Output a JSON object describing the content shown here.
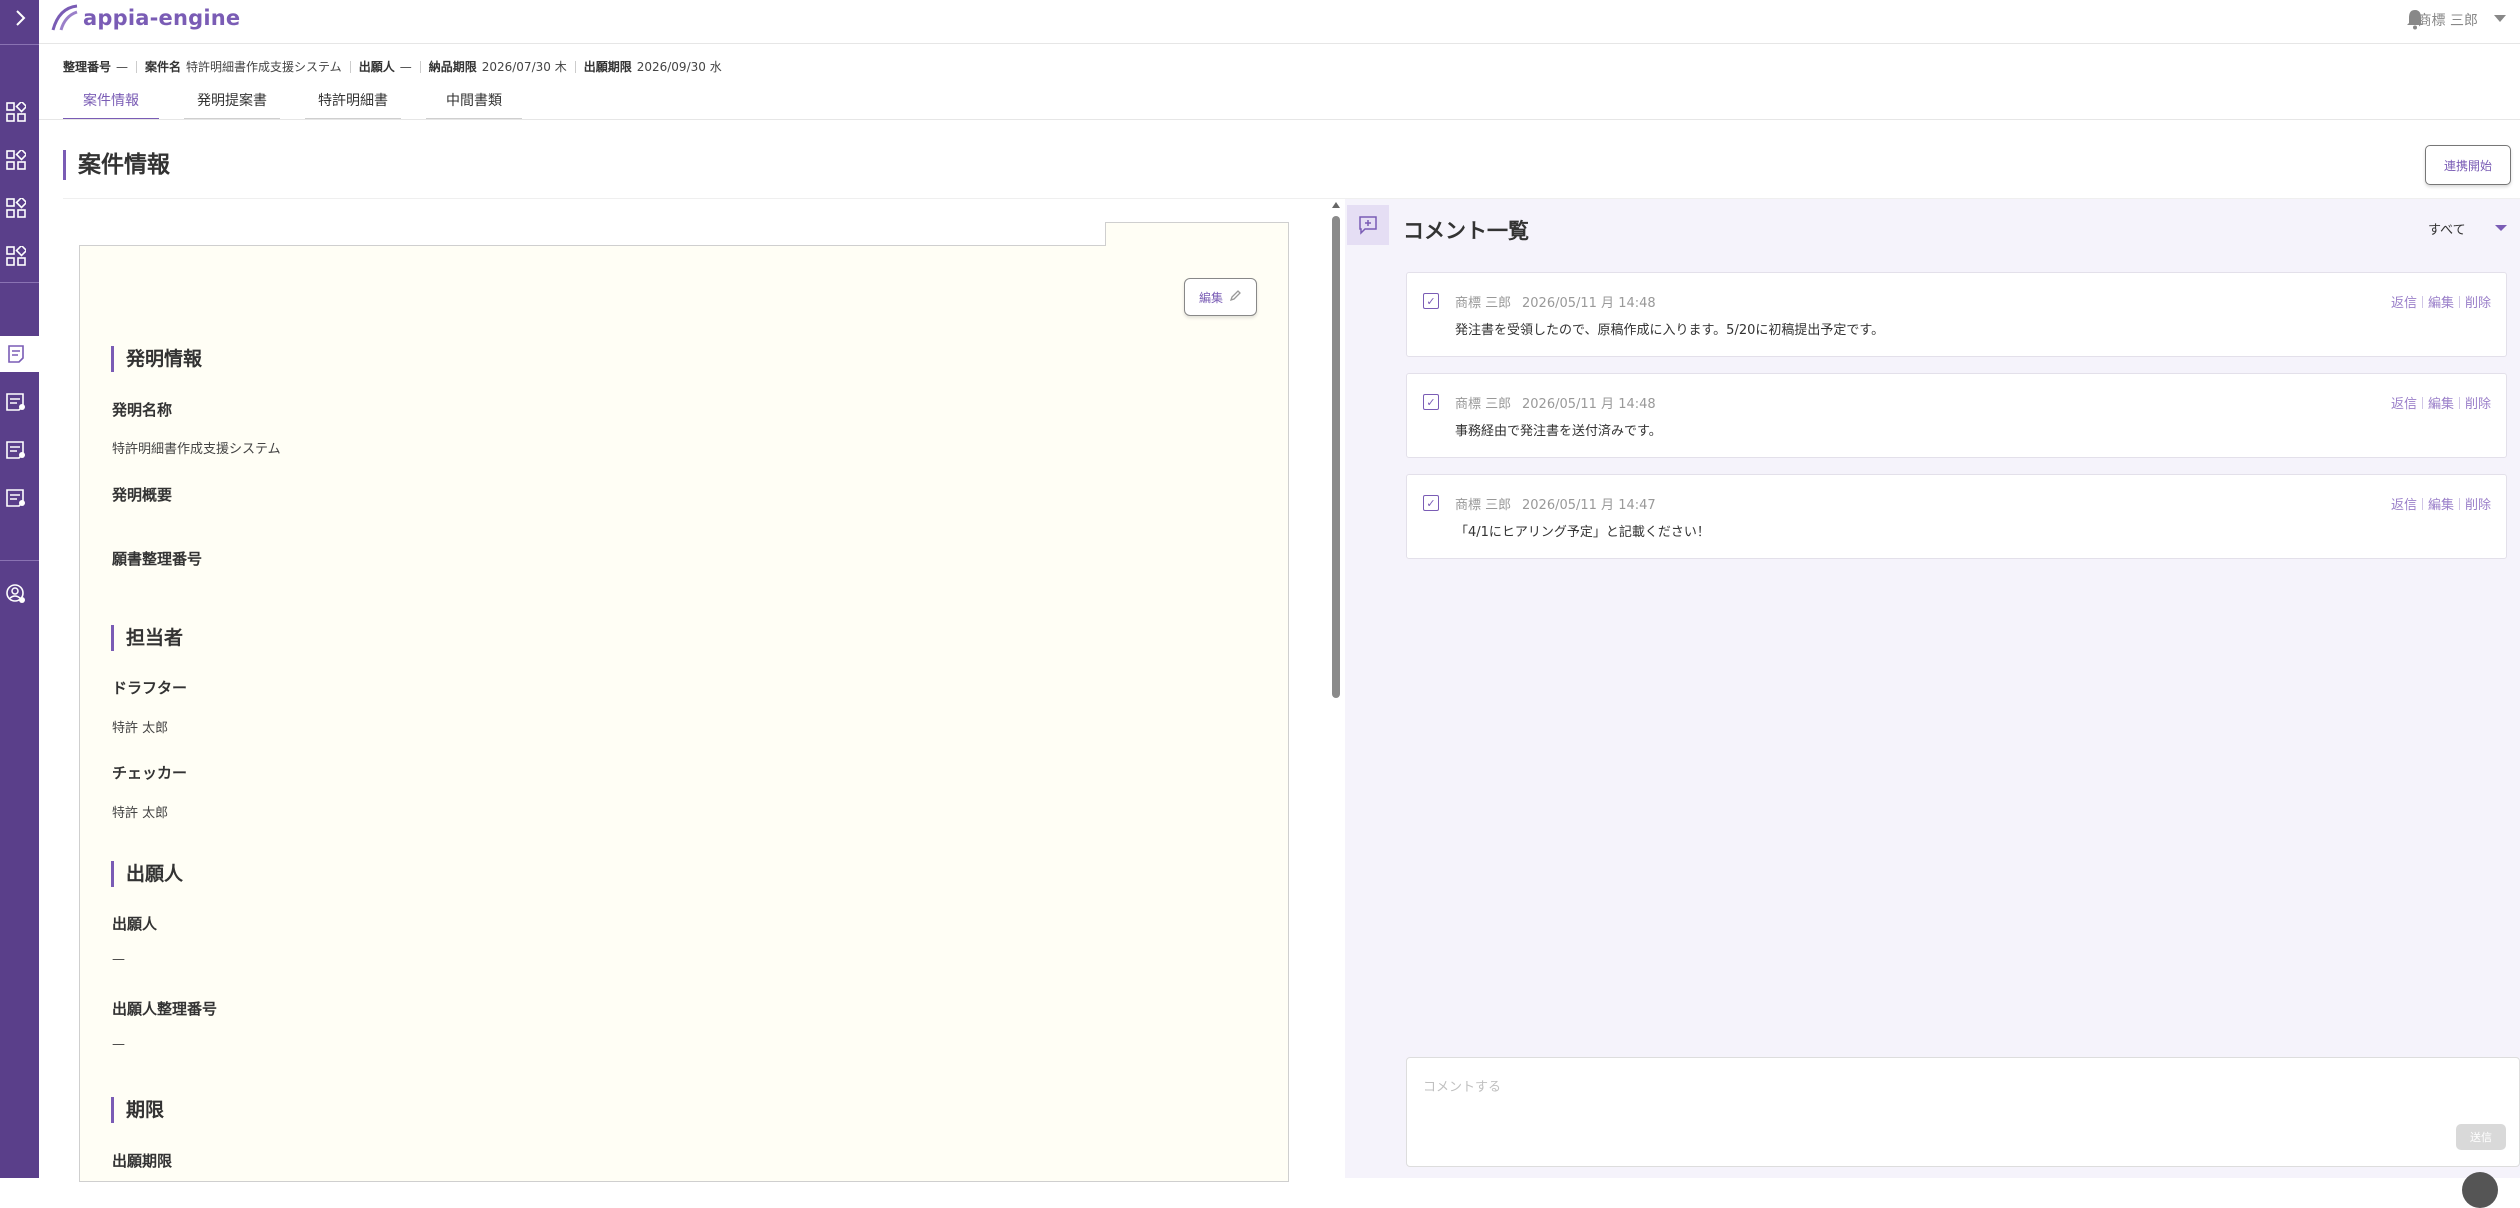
{
  "app": {
    "logo_text": "appia-engine",
    "user_name": "商標 三郎"
  },
  "meta": {
    "items": [
      {
        "label": "整理番号",
        "value": "—"
      },
      {
        "label": "案件名",
        "value": "特許明細書作成支援システム"
      },
      {
        "label": "出願人",
        "value": "—"
      },
      {
        "label": "納品期限",
        "value": "2026/07/30 木"
      },
      {
        "label": "出願期限",
        "value": "2026/09/30 水"
      }
    ]
  },
  "tabs": [
    {
      "label": "案件情報",
      "active": true
    },
    {
      "label": "発明提案書",
      "active": false
    },
    {
      "label": "特許明細書",
      "active": false
    },
    {
      "label": "中間書類",
      "active": false
    }
  ],
  "page": {
    "title": "案件情報",
    "start_button": "連携開始"
  },
  "card": {
    "edit_label": "編集",
    "sections": [
      {
        "heading": "発明情報"
      },
      {
        "heading": "担当者"
      },
      {
        "heading": "出願人"
      },
      {
        "heading": "期限"
      }
    ],
    "fields": {
      "invention_name": {
        "label": "発明名称",
        "value": "特許明細書作成支援システム"
      },
      "invention_summary": {
        "label": "発明概要",
        "value": ""
      },
      "docket_number": {
        "label": "願書整理番号",
        "value": ""
      },
      "drafter": {
        "label": "ドラフター",
        "value": "特許 太郎"
      },
      "checker": {
        "label": "チェッカー",
        "value": "特許 太郎"
      },
      "applicant": {
        "label": "出願人",
        "value": "—"
      },
      "applicant_docket": {
        "label": "出願人整理番号",
        "value": "—"
      },
      "filing_deadline": {
        "label": "出願期限",
        "value": ""
      }
    }
  },
  "comments": {
    "title": "コメント一覧",
    "filter": "すべて",
    "actions": {
      "reply": "返信",
      "edit": "編集",
      "delete": "削除"
    },
    "items": [
      {
        "author": "商標 三郎",
        "datetime": "2026/05/11 月 14:48",
        "text": "発注書を受領したので、原稿作成に入ります。5/20に初稿提出予定です。"
      },
      {
        "author": "商標 三郎",
        "datetime": "2026/05/11 月 14:48",
        "text": "事務経由で発注書を送付済みです。"
      },
      {
        "author": "商標 三郎",
        "datetime": "2026/05/11 月 14:47",
        "text": "「4/1にヒアリング予定」と記載ください！"
      }
    ],
    "input_placeholder": "コメントする",
    "send_label": "送信"
  },
  "colors": {
    "accent": "#7a5cb5",
    "sidebar": "#5a3f8a",
    "card_bg": "#fffef5",
    "panel_bg": "#f5f3fb"
  },
  "icons": [
    "chevron-right-icon",
    "dashboard-icon",
    "document-list-icon",
    "user-settings-icon",
    "bell-icon",
    "caret-down-icon",
    "pencil-icon",
    "add-comment-icon",
    "checkbox-icon"
  ]
}
